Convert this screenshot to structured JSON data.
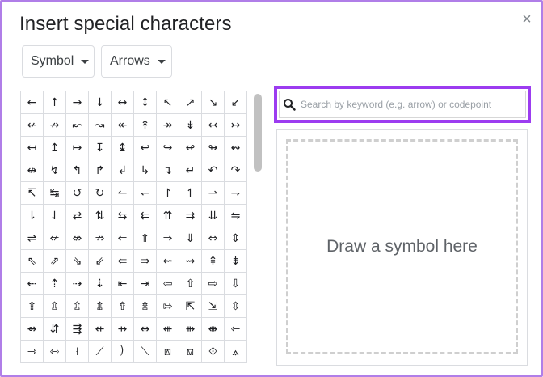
{
  "dialog": {
    "title": "Insert special characters",
    "close_label": "×"
  },
  "dropdowns": {
    "category": "Symbol",
    "subcategory": "Arrows"
  },
  "search": {
    "placeholder": "Search by keyword (e.g. arrow) or codepoint",
    "value": ""
  },
  "draw": {
    "label": "Draw a symbol here"
  },
  "symbols": [
    [
      "←",
      "↑",
      "→",
      "↓",
      "↔",
      "↕",
      "↖",
      "↗",
      "↘",
      "↙"
    ],
    [
      "↚",
      "↛",
      "↜",
      "↝",
      "↞",
      "↟",
      "↠",
      "↡",
      "↢",
      "↣"
    ],
    [
      "↤",
      "↥",
      "↦",
      "↧",
      "↨",
      "↩",
      "↪",
      "↫",
      "↬",
      "↭"
    ],
    [
      "↮",
      "↯",
      "↰",
      "↱",
      "↲",
      "↳",
      "↴",
      "↵",
      "↶",
      "↷"
    ],
    [
      "↸",
      "↹",
      "↺",
      "↻",
      "↼",
      "↽",
      "↾",
      "↿",
      "⇀",
      "⇁"
    ],
    [
      "⇂",
      "⇃",
      "⇄",
      "⇅",
      "⇆",
      "⇇",
      "⇈",
      "⇉",
      "⇊",
      "⇋"
    ],
    [
      "⇌",
      "⇍",
      "⇎",
      "⇏",
      "⇐",
      "⇑",
      "⇒",
      "⇓",
      "⇔",
      "⇕"
    ],
    [
      "⇖",
      "⇗",
      "⇘",
      "⇙",
      "⇚",
      "⇛",
      "⇜",
      "⇝",
      "⇞",
      "⇟"
    ],
    [
      "⇠",
      "⇡",
      "⇢",
      "⇣",
      "⇤",
      "⇥",
      "⇦",
      "⇧",
      "⇨",
      "⇩"
    ],
    [
      "⇪",
      "⇫",
      "⇬",
      "⇭",
      "⇮",
      "⇯",
      "⇰",
      "⇱",
      "⇲",
      "⇳"
    ],
    [
      "⇴",
      "⇵",
      "⇶",
      "⇷",
      "⇸",
      "⇹",
      "⇺",
      "⇻",
      "⇼",
      "⇽"
    ],
    [
      "⇾",
      "⇿",
      "⟊",
      "⟋",
      "⟌",
      "⟍",
      "⟎",
      "⟏",
      "⟐",
      "⟑"
    ]
  ],
  "colors": {
    "dialog_border": "#b07ee8",
    "search_highlight": "#9c3cf0"
  }
}
